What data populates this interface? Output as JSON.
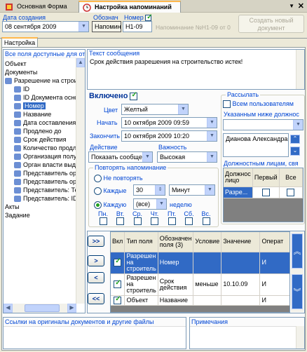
{
  "tabs": [
    {
      "label": "Основная Форма"
    },
    {
      "label": "Настройка напоминаний"
    }
  ],
  "header": {
    "date_label": "Дата создания",
    "date_value": "08 сентября 2009",
    "designation_label": "Обознач",
    "designation_value": "Напомин",
    "number_label": "Номер",
    "number_value": "Н1-09",
    "static_note": "Напоминание №Н1-09 от 0",
    "create_button": "Создать новый документ"
  },
  "subtab": "Настройка",
  "left_panel": {
    "title": "Все поля доступные для от",
    "items": [
      {
        "label": "Объект",
        "level": 0,
        "icon": false
      },
      {
        "label": "Документы",
        "level": 0,
        "icon": false
      },
      {
        "label": "Разрешение на строите...",
        "level": 0,
        "icon": true
      },
      {
        "label": "ID",
        "level": 1,
        "icon": true
      },
      {
        "label": "ID Документа основ",
        "level": 1,
        "icon": true
      },
      {
        "label": "Номер",
        "level": 1,
        "icon": true,
        "selected": true
      },
      {
        "label": "Название",
        "level": 1,
        "icon": true
      },
      {
        "label": "Дата составления",
        "level": 1,
        "icon": true
      },
      {
        "label": "Продлено до",
        "level": 1,
        "icon": true
      },
      {
        "label": "Срок действия",
        "level": 1,
        "icon": true
      },
      {
        "label": "Количество продлен",
        "level": 1,
        "icon": true
      },
      {
        "label": "Организация получа",
        "level": 1,
        "icon": true
      },
      {
        "label": "Орган власти выдав",
        "level": 1,
        "icon": true
      },
      {
        "label": "Представитель орга",
        "level": 1,
        "icon": true
      },
      {
        "label": "Представитель орга",
        "level": 1,
        "icon": true
      },
      {
        "label": "Представитель: Тек",
        "level": 1,
        "icon": true
      },
      {
        "label": "Представитель: ID",
        "level": 1,
        "icon": true
      },
      {
        "label": "Акты",
        "level": 0,
        "icon": false
      },
      {
        "label": "Задание",
        "level": 0,
        "icon": false
      }
    ]
  },
  "message": {
    "label": "Текст сообщения",
    "value": "Срок действия разрешения на строительство истек!"
  },
  "settings": {
    "enabled_label": "Включено",
    "enabled": true,
    "color_label": "Цвет",
    "color_value": "Желтый",
    "start_label": "Начать",
    "start_value": "10 октября 2009 09:59",
    "end_label": "Закончить",
    "end_value": "10 октября 2009 10:20",
    "action_label": "Действие",
    "action_value": "Показать сообще",
    "importance_label": "Важность",
    "importance_value": "Высокая"
  },
  "repeat": {
    "title": "Повторять напоминание",
    "opt_none": "Не повторять",
    "opt_every": "Каждые",
    "every_value": "30",
    "every_unit": "Минут",
    "opt_each": "Каждую",
    "each_value": "(все)",
    "each_unit": "неделю",
    "days": [
      "Пн.",
      "Вт.",
      "Ср.",
      "Чт.",
      "Пт.",
      "Сб.",
      "Вс."
    ]
  },
  "send": {
    "title": "Рассылать",
    "all_users": "Всем пользователям",
    "below_label": "Указанным ниже должнос",
    "person": "Дианова Александра",
    "officials_label": "Должностным лицам, свя",
    "grid_headers": [
      "Должнос лицо",
      "Первый",
      "Все"
    ],
    "grid_rows": [
      {
        "name": "Разре...",
        "first": false,
        "all": false
      }
    ]
  },
  "conditions": {
    "headers": [
      "Вкл",
      "Тип поля",
      "Обозначен поля (3)",
      "Условие",
      "Значение",
      "Операт"
    ],
    "rows": [
      {
        "on": true,
        "type": "Разрешен на строитель",
        "field": "Номер",
        "cond": "",
        "value": "",
        "op": "И",
        "selected": true
      },
      {
        "on": true,
        "type": "Разрешен на строитель",
        "field": "Срок действия",
        "cond": "меньше",
        "value": "10.10.09",
        "op": "И",
        "selected": false
      },
      {
        "on": true,
        "type": "Объект",
        "field": "Название",
        "cond": "",
        "value": "",
        "op": "И",
        "selected": false
      }
    ],
    "move_buttons": [
      ">>",
      ">",
      "<",
      "<<"
    ]
  },
  "bottom": {
    "links_label": "Ссылки на оригиналы документов и другие файлы",
    "notes_label": "Примечания"
  },
  "colors": {
    "accent": "#316ac5",
    "label": "#0046d5",
    "tab_highlight": "#ffb84d"
  }
}
